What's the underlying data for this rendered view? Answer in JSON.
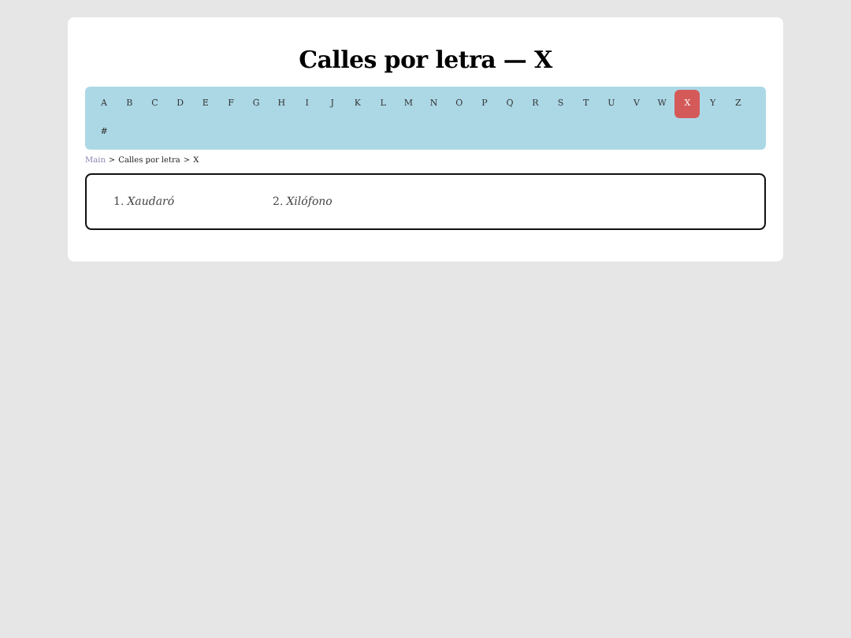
{
  "title": "Calles por letra — X",
  "letters": [
    {
      "label": "A",
      "selected": false
    },
    {
      "label": "B",
      "selected": false
    },
    {
      "label": "C",
      "selected": false
    },
    {
      "label": "D",
      "selected": false
    },
    {
      "label": "E",
      "selected": false
    },
    {
      "label": "F",
      "selected": false
    },
    {
      "label": "G",
      "selected": false
    },
    {
      "label": "H",
      "selected": false
    },
    {
      "label": "I",
      "selected": false
    },
    {
      "label": "J",
      "selected": false
    },
    {
      "label": "K",
      "selected": false
    },
    {
      "label": "L",
      "selected": false
    },
    {
      "label": "M",
      "selected": false
    },
    {
      "label": "N",
      "selected": false
    },
    {
      "label": "O",
      "selected": false
    },
    {
      "label": "P",
      "selected": false
    },
    {
      "label": "Q",
      "selected": false
    },
    {
      "label": "R",
      "selected": false
    },
    {
      "label": "S",
      "selected": false
    },
    {
      "label": "T",
      "selected": false
    },
    {
      "label": "U",
      "selected": false
    },
    {
      "label": "V",
      "selected": false
    },
    {
      "label": "W",
      "selected": false
    },
    {
      "label": "X",
      "selected": true
    },
    {
      "label": "Y",
      "selected": false
    },
    {
      "label": "Z",
      "selected": false
    },
    {
      "label": "#",
      "selected": false
    }
  ],
  "breadcrumb": {
    "separator": ">",
    "items": [
      {
        "label": "Main",
        "kind": "link"
      },
      {
        "label": "Calles por letra",
        "kind": "text"
      },
      {
        "label": "X",
        "kind": "text"
      }
    ]
  },
  "streets": [
    {
      "number": "1.",
      "name": "Xaudaró"
    },
    {
      "number": "2.",
      "name": "Xilófono"
    }
  ]
}
